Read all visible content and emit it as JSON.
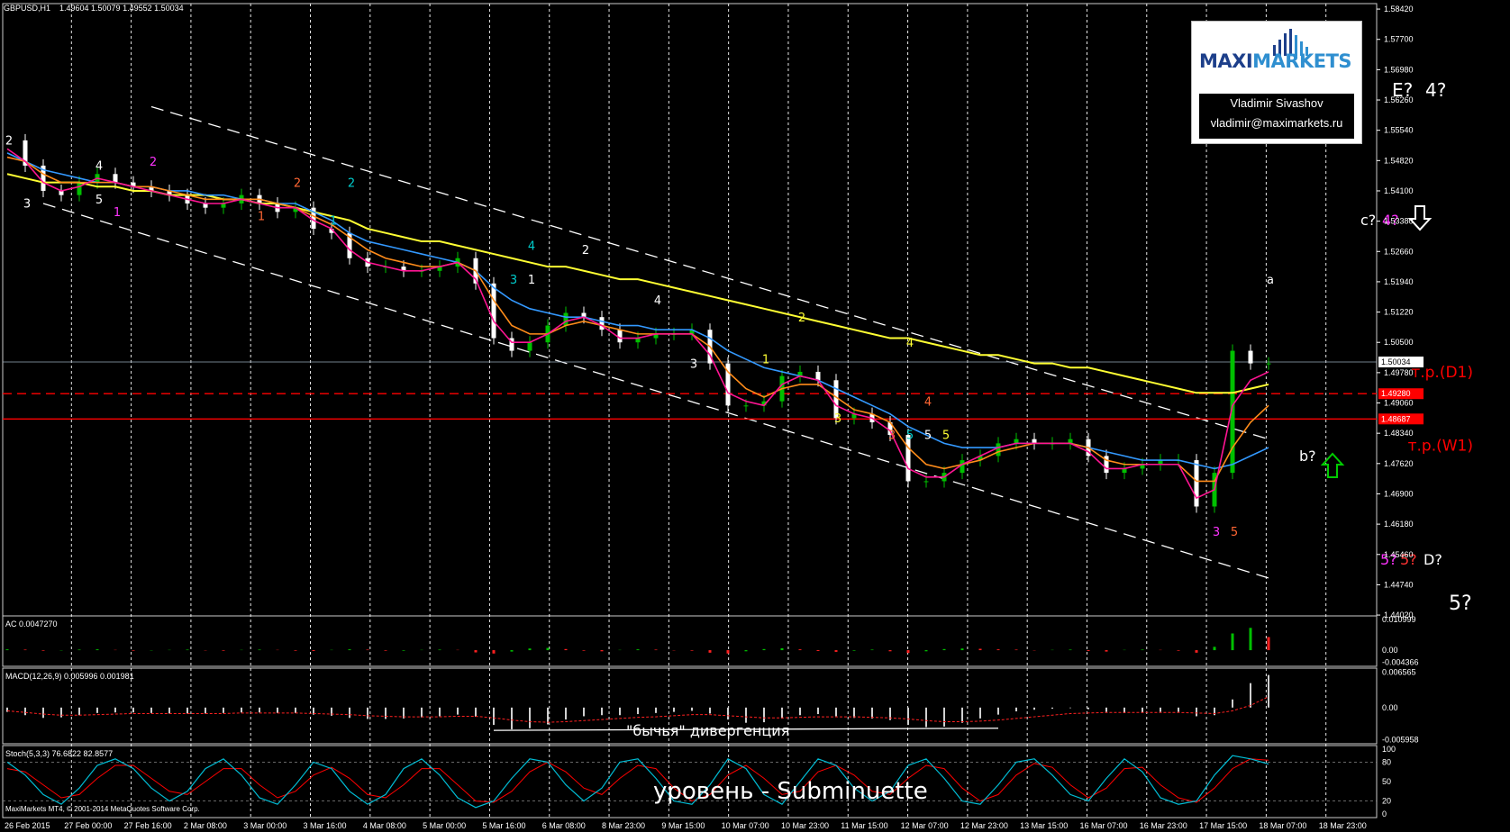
{
  "header": {
    "symbol": "GBPUSD,H1",
    "ohlc": "1.49604 1.50079 1.49552 1.50034"
  },
  "logo": {
    "brand_part1": "MAXI",
    "brand_part2": "MARKETS",
    "author_name": "Vladimir Sivashov",
    "author_email": "vladimir@maximarkets.ru"
  },
  "colors": {
    "background": "#000000",
    "candle_up": "#00c000",
    "candle_down": "#ffffff",
    "ma_yellow": "#ffff33",
    "ma_blue": "#3399ff",
    "ma_orange": "#ff8c1a",
    "ma_magenta": "#ff1493",
    "level_red": "#ff0000",
    "channel": "#ffffff",
    "stoch_main": "#00bcd4",
    "stoch_signal": "#ff0000"
  },
  "chart_data": {
    "type": "line",
    "symbol": "GBPUSD",
    "timeframe": "H1",
    "ylim": [
      1.44,
      1.5855
    ],
    "x_tick_labels": [
      "26 Feb 2015",
      "27 Feb 00:00",
      "27 Feb 16:00",
      "2 Mar 08:00",
      "3 Mar 00:00",
      "3 Mar 16:00",
      "4 Mar 08:00",
      "5 Mar 00:00",
      "5 Mar 16:00",
      "6 Mar 08:00",
      "8 Mar 23:00",
      "9 Mar 15:00",
      "10 Mar 07:00",
      "10 Mar 23:00",
      "11 Mar 15:00",
      "12 Mar 07:00",
      "12 Mar 23:00",
      "13 Mar 15:00",
      "16 Mar 07:00",
      "16 Mar 23:00",
      "17 Mar 15:00",
      "18 Mar 07:00",
      "18 Mar 23:00"
    ],
    "y_tick_labels": [
      "1.58420",
      "1.57700",
      "1.56980",
      "1.56260",
      "1.55540",
      "1.54820",
      "1.54100",
      "1.53380",
      "1.52660",
      "1.51940",
      "1.51220",
      "1.50500",
      "1.49780",
      "1.49060",
      "1.48340",
      "1.47620",
      "1.46900",
      "1.46180",
      "1.45460",
      "1.44740",
      "1.44020"
    ],
    "price_line": 1.50034,
    "price_label": "1.50034",
    "levels": [
      {
        "label": "т.р.(D1)",
        "value": 1.4928,
        "price_label": "1.49280",
        "style": "dashed"
      },
      {
        "label": "т.р.(W1)",
        "value": 1.4868,
        "price_label": "1.48687",
        "style": "solid"
      }
    ],
    "series": [
      {
        "name": "price",
        "values": [
          1.553,
          1.547,
          1.541,
          1.54,
          1.543,
          1.545,
          1.543,
          1.542,
          1.541,
          1.54,
          1.538,
          1.537,
          1.538,
          1.54,
          1.538,
          1.536,
          1.537,
          1.532,
          1.531,
          1.525,
          1.523,
          1.523,
          1.522,
          1.522,
          1.523,
          1.525,
          1.519,
          1.506,
          1.503,
          1.505,
          1.509,
          1.512,
          1.511,
          1.508,
          1.505,
          1.506,
          1.507,
          1.507,
          1.508,
          1.5,
          1.49,
          1.49,
          1.491,
          1.497,
          1.498,
          1.496,
          1.487,
          1.488,
          1.486,
          1.483,
          1.472,
          1.472,
          1.474,
          1.477,
          1.478,
          1.481,
          1.482,
          1.481,
          1.481,
          1.482,
          1.478,
          1.474,
          1.475,
          1.476,
          1.477,
          1.477,
          1.466,
          1.474,
          1.503,
          1.5,
          1.5
        ]
      },
      {
        "values": [
          1.545,
          1.544,
          1.543,
          1.543,
          1.543,
          1.542,
          1.542,
          1.541,
          1.541,
          1.54,
          1.54,
          1.54,
          1.539,
          1.539,
          1.538,
          1.538,
          1.537,
          1.536,
          1.535,
          1.534,
          1.532,
          1.531,
          1.53,
          1.529,
          1.529,
          1.528,
          1.527,
          1.526,
          1.525,
          1.524,
          1.523,
          1.523,
          1.522,
          1.521,
          1.52,
          1.52,
          1.519,
          1.518,
          1.517,
          1.516,
          1.515,
          1.514,
          1.513,
          1.512,
          1.511,
          1.51,
          1.509,
          1.508,
          1.507,
          1.506,
          1.506,
          1.505,
          1.504,
          1.503,
          1.502,
          1.502,
          1.501,
          1.5,
          1.5,
          1.499,
          1.499,
          1.498,
          1.497,
          1.496,
          1.495,
          1.494,
          1.493,
          1.493,
          1.493,
          1.494,
          1.495
        ]
      },
      {
        "values": [
          1.55,
          1.548,
          1.546,
          1.545,
          1.544,
          1.543,
          1.543,
          1.542,
          1.542,
          1.541,
          1.541,
          1.54,
          1.54,
          1.539,
          1.539,
          1.538,
          1.538,
          1.536,
          1.534,
          1.531,
          1.529,
          1.528,
          1.527,
          1.526,
          1.525,
          1.524,
          1.522,
          1.518,
          1.515,
          1.513,
          1.512,
          1.511,
          1.511,
          1.51,
          1.509,
          1.509,
          1.508,
          1.508,
          1.508,
          1.506,
          1.503,
          1.501,
          1.499,
          1.498,
          1.497,
          1.496,
          1.494,
          1.492,
          1.49,
          1.488,
          1.485,
          1.483,
          1.481,
          1.48,
          1.48,
          1.48,
          1.481,
          1.481,
          1.481,
          1.481,
          1.48,
          1.479,
          1.478,
          1.477,
          1.477,
          1.477,
          1.476,
          1.475,
          1.476,
          1.478,
          1.48
        ]
      },
      {
        "values": [
          1.549,
          1.548,
          1.545,
          1.543,
          1.543,
          1.543,
          1.543,
          1.542,
          1.542,
          1.541,
          1.54,
          1.539,
          1.539,
          1.539,
          1.539,
          1.538,
          1.537,
          1.535,
          1.533,
          1.53,
          1.527,
          1.525,
          1.524,
          1.523,
          1.523,
          1.524,
          1.522,
          1.515,
          1.509,
          1.507,
          1.507,
          1.509,
          1.51,
          1.509,
          1.508,
          1.507,
          1.507,
          1.507,
          1.507,
          1.504,
          1.498,
          1.494,
          1.492,
          1.494,
          1.495,
          1.495,
          1.492,
          1.489,
          1.488,
          1.486,
          1.48,
          1.476,
          1.475,
          1.476,
          1.477,
          1.479,
          1.48,
          1.481,
          1.481,
          1.481,
          1.48,
          1.477,
          1.476,
          1.476,
          1.476,
          1.476,
          1.472,
          1.472,
          1.48,
          1.486,
          1.49
        ]
      },
      {
        "values": [
          1.551,
          1.548,
          1.543,
          1.541,
          1.542,
          1.544,
          1.543,
          1.542,
          1.541,
          1.54,
          1.539,
          1.538,
          1.538,
          1.539,
          1.538,
          1.537,
          1.537,
          1.534,
          1.532,
          1.527,
          1.524,
          1.523,
          1.522,
          1.522,
          1.523,
          1.524,
          1.52,
          1.51,
          1.505,
          1.505,
          1.507,
          1.51,
          1.511,
          1.509,
          1.506,
          1.506,
          1.507,
          1.507,
          1.507,
          1.502,
          1.493,
          1.491,
          1.49,
          1.495,
          1.497,
          1.496,
          1.49,
          1.488,
          1.487,
          1.484,
          1.475,
          1.473,
          1.473,
          1.476,
          1.478,
          1.48,
          1.481,
          1.481,
          1.481,
          1.481,
          1.479,
          1.475,
          1.475,
          1.476,
          1.476,
          1.476,
          1.468,
          1.47,
          1.49,
          1.496,
          1.498
        ]
      }
    ],
    "channel": [
      {
        "start": [
          8,
          1.561
        ],
        "end": [
          70,
          1.482
        ]
      },
      {
        "start": [
          2,
          1.538
        ],
        "end": [
          70,
          1.449
        ]
      }
    ],
    "wave_labels": [
      {
        "text": "2",
        "i": 0,
        "y": 1.552,
        "color": "#ffffff"
      },
      {
        "text": "3",
        "i": 1,
        "y": 1.537,
        "color": "#ffffff"
      },
      {
        "text": "4",
        "i": 5,
        "y": 1.546,
        "color": "#ffffff"
      },
      {
        "text": "5",
        "i": 5,
        "y": 1.538,
        "color": "#ffffff"
      },
      {
        "text": "1",
        "i": 6,
        "y": 1.535,
        "color": "#ff33ff"
      },
      {
        "text": "2",
        "i": 8,
        "y": 1.547,
        "color": "#ff33ff"
      },
      {
        "text": "1",
        "i": 14,
        "y": 1.534,
        "color": "#ff6633"
      },
      {
        "text": "2",
        "i": 16,
        "y": 1.542,
        "color": "#ff6633"
      },
      {
        "text": "2",
        "i": 19,
        "y": 1.542,
        "color": "#00cccc"
      },
      {
        "text": "1",
        "i": 18,
        "y": 1.533,
        "color": "#00cccc"
      },
      {
        "text": "4",
        "i": 29,
        "y": 1.527,
        "color": "#00cccc"
      },
      {
        "text": "3",
        "i": 28,
        "y": 1.519,
        "color": "#00cccc"
      },
      {
        "text": "1",
        "i": 29,
        "y": 1.519,
        "color": "#ffffff"
      },
      {
        "text": "2",
        "i": 32,
        "y": 1.526,
        "color": "#ffffff"
      },
      {
        "text": "4",
        "i": 36,
        "y": 1.514,
        "color": "#ffffff"
      },
      {
        "text": "3",
        "i": 38,
        "y": 1.499,
        "color": "#ffffff"
      },
      {
        "text": "2",
        "i": 44,
        "y": 1.51,
        "color": "#ffff33"
      },
      {
        "text": "1",
        "i": 42,
        "y": 1.5,
        "color": "#ffff33"
      },
      {
        "text": "4",
        "i": 50,
        "y": 1.504,
        "color": "#ffff33"
      },
      {
        "text": "3",
        "i": 46,
        "y": 1.486,
        "color": "#ffff33"
      },
      {
        "text": "4",
        "i": 51,
        "y": 1.49,
        "color": "#ff6633"
      },
      {
        "text": "3",
        "i": 49,
        "y": 1.482,
        "color": "#ff6633"
      },
      {
        "text": "5",
        "i": 50,
        "y": 1.482,
        "color": "#00cccc"
      },
      {
        "text": "5",
        "i": 51,
        "y": 1.482,
        "color": "#ffffff"
      },
      {
        "text": "5",
        "i": 52,
        "y": 1.482,
        "color": "#ffff33"
      },
      {
        "text": "3",
        "i": 67,
        "y": 1.459,
        "color": "#ff33ff"
      },
      {
        "text": "5",
        "i": 68,
        "y": 1.459,
        "color": "#ff6633"
      },
      {
        "text": "a",
        "i": 70,
        "y": 1.519,
        "color": "#ffffff"
      }
    ],
    "annotations": [
      {
        "text": "E?",
        "y": 1.5645,
        "color": "#ffffff",
        "size": 20,
        "x_offset": 0
      },
      {
        "text": "4?",
        "y": 1.5645,
        "color": "#ffffff",
        "size": 20,
        "x_offset": 1
      },
      {
        "text": "c?",
        "y": 1.5355,
        "color": "#ffffff",
        "size": 16,
        "x_offset": 2
      },
      {
        "text": "4?",
        "y": 1.5355,
        "color": "#ff33ff",
        "size": 16,
        "x_offset": 3
      },
      {
        "text": "b?",
        "y": 1.479,
        "color": "#ffffff",
        "size": 16,
        "x_offset": 4
      },
      {
        "text": "5?",
        "y": 1.453,
        "color": "#ff33ff",
        "size": 16,
        "x_offset": 5
      },
      {
        "text": "5?",
        "y": 1.453,
        "color": "#ff3333",
        "size": 16,
        "x_offset": 6
      },
      {
        "text": "D?",
        "y": 1.453,
        "color": "#ffffff",
        "size": 16,
        "x_offset": 7
      },
      {
        "text": "5?",
        "y": 1.4405,
        "color": "#ffffff",
        "size": 22,
        "x_offset": 8
      }
    ],
    "arrows": [
      {
        "direction": "down",
        "color": "#ffffff",
        "y": 1.5355
      },
      {
        "direction": "up",
        "color": "#00cc00",
        "y": 1.477
      }
    ]
  },
  "indicators": {
    "ac": {
      "label": "AC 0.0047270",
      "scale": [
        "0.010999",
        "0.00",
        "-0.004366"
      ],
      "values": [
        0.0003,
        0.0002,
        -0.0002,
        -0.0001,
        0.0002,
        0.0003,
        0.0001,
        -0.0002,
        -0.0001,
        0.0001,
        0.0002,
        -0.0001,
        -0.0002,
        0.0001,
        0.0002,
        0.0001,
        -0.0002,
        -0.0003,
        0.0001,
        0.0003,
        0.0002,
        -0.0002,
        -0.0002,
        0.0001,
        0.0002,
        0.0001,
        -0.0008,
        -0.0012,
        -0.0005,
        0.0006,
        0.0008,
        0.0004,
        -0.0002,
        -0.0004,
        0.0001,
        0.0003,
        0.0002,
        -0.0001,
        -0.0002,
        -0.0009,
        -0.0012,
        -0.0004,
        0.0004,
        0.0007,
        0.0003,
        -0.0003,
        -0.0006,
        -0.0002,
        0.0002,
        -0.0004,
        -0.001,
        -0.0004,
        0.0004,
        0.0006,
        0.0005,
        0.0003,
        0.0002,
        -0.0001,
        0.0001,
        0.0002,
        -0.0003,
        -0.0005,
        0.0001,
        0.0002,
        0.0001,
        -0.0002,
        -0.0009,
        0.0012,
        0.006,
        0.008,
        0.0047
      ]
    },
    "macd": {
      "label": "MACD(12,26,9) 0.005996 0.001981",
      "scale": [
        "0.006565",
        "0.00",
        "-0.005958"
      ],
      "divergence_label": "\"бычья\" дивергенция",
      "values": [
        -0.0008,
        -0.0014,
        -0.0019,
        -0.0018,
        -0.0014,
        -0.001,
        -0.0009,
        -0.0009,
        -0.001,
        -0.0011,
        -0.0011,
        -0.0011,
        -0.001,
        -0.0009,
        -0.0009,
        -0.001,
        -0.001,
        -0.0013,
        -0.0015,
        -0.0019,
        -0.0021,
        -0.0021,
        -0.002,
        -0.0018,
        -0.0016,
        -0.0013,
        -0.0017,
        -0.0032,
        -0.004,
        -0.0038,
        -0.0031,
        -0.0022,
        -0.0016,
        -0.0014,
        -0.0014,
        -0.0012,
        -0.001,
        -0.0008,
        -0.0006,
        -0.0011,
        -0.0022,
        -0.0028,
        -0.0027,
        -0.002,
        -0.0014,
        -0.0012,
        -0.0016,
        -0.0019,
        -0.002,
        -0.0023,
        -0.0032,
        -0.0036,
        -0.0035,
        -0.0028,
        -0.002,
        -0.0013,
        -0.0007,
        -0.0004,
        -0.0002,
        -0.0001,
        -0.0003,
        -0.0008,
        -0.001,
        -0.0009,
        -0.0008,
        -0.0008,
        -0.0016,
        -0.0014,
        0.0015,
        0.0045,
        0.006
      ],
      "signal": [
        -0.0006,
        -0.0009,
        -0.0012,
        -0.0014,
        -0.0014,
        -0.0013,
        -0.0012,
        -0.0011,
        -0.0011,
        -0.0011,
        -0.0011,
        -0.0011,
        -0.0011,
        -0.001,
        -0.001,
        -0.001,
        -0.001,
        -0.0011,
        -0.0012,
        -0.0013,
        -0.0015,
        -0.0016,
        -0.0017,
        -0.0017,
        -0.0017,
        -0.0016,
        -0.0016,
        -0.0019,
        -0.0023,
        -0.0026,
        -0.0027,
        -0.0026,
        -0.0024,
        -0.0022,
        -0.002,
        -0.0018,
        -0.0017,
        -0.0015,
        -0.0013,
        -0.0013,
        -0.0015,
        -0.0017,
        -0.0019,
        -0.0019,
        -0.0018,
        -0.0017,
        -0.0017,
        -0.0017,
        -0.0018,
        -0.0019,
        -0.0021,
        -0.0024,
        -0.0026,
        -0.0026,
        -0.0025,
        -0.0023,
        -0.002,
        -0.0017,
        -0.0014,
        -0.0011,
        -0.001,
        -0.0009,
        -0.0009,
        -0.0009,
        -0.0009,
        -0.0009,
        -0.001,
        -0.0011,
        -0.0006,
        0.0004,
        0.002
      ]
    },
    "stoch": {
      "label": "Stoch(5,3,3) 76.6822 82.8577",
      "scale": [
        "100",
        "80",
        "50",
        "20",
        "0"
      ],
      "caption": "уровень - Subminuette",
      "main": [
        80,
        60,
        30,
        15,
        40,
        75,
        85,
        70,
        40,
        20,
        35,
        70,
        85,
        60,
        25,
        15,
        45,
        80,
        70,
        35,
        15,
        30,
        70,
        85,
        60,
        25,
        10,
        20,
        55,
        85,
        80,
        45,
        20,
        40,
        80,
        85,
        55,
        20,
        15,
        45,
        85,
        70,
        30,
        15,
        50,
        85,
        75,
        40,
        20,
        35,
        75,
        85,
        55,
        20,
        15,
        45,
        80,
        85,
        60,
        30,
        20,
        55,
        85,
        65,
        25,
        15,
        20,
        60,
        90,
        85,
        77
      ],
      "signal": [
        70,
        65,
        45,
        25,
        30,
        55,
        75,
        75,
        55,
        35,
        30,
        50,
        70,
        70,
        45,
        25,
        35,
        60,
        72,
        55,
        30,
        25,
        45,
        70,
        70,
        45,
        20,
        18,
        35,
        65,
        80,
        65,
        40,
        30,
        55,
        75,
        70,
        40,
        20,
        30,
        60,
        75,
        55,
        30,
        35,
        65,
        75,
        60,
        35,
        30,
        55,
        75,
        70,
        40,
        20,
        30,
        60,
        78,
        72,
        45,
        25,
        40,
        70,
        72,
        45,
        25,
        18,
        40,
        70,
        85,
        83
      ]
    }
  },
  "footer": {
    "copyright": "MaxiMarkets MT4, © 2001-2014 MetaQuotes Software Corp."
  }
}
